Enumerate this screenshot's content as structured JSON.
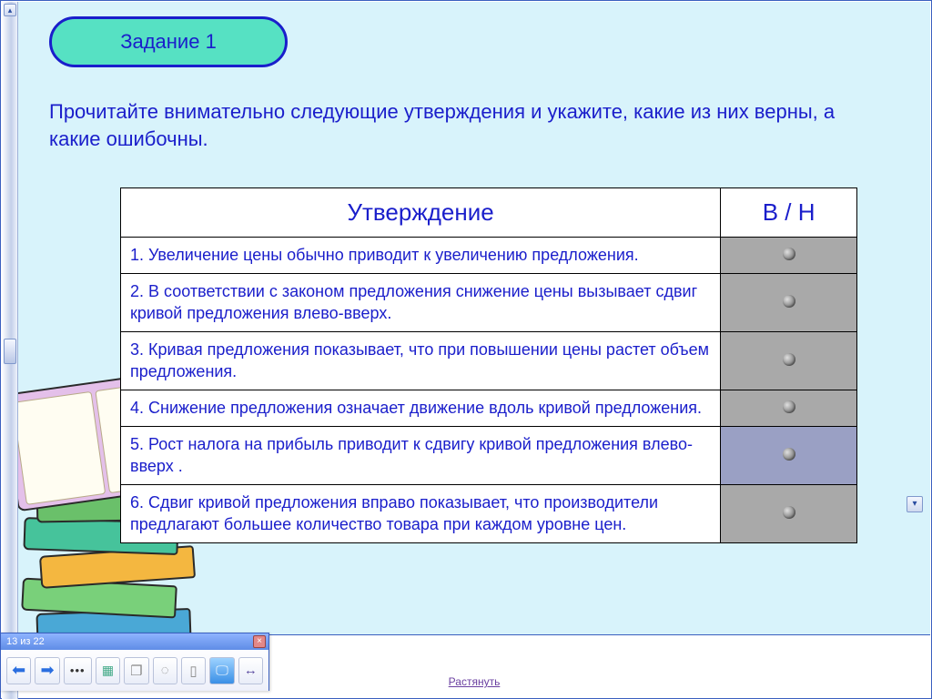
{
  "task": {
    "badge_label": "Задание 1",
    "instruction": "Прочитайте внимательно следующие утверждения и укажите, какие из них верны, а какие ошибочны."
  },
  "table": {
    "header_statement": "Утверждение",
    "header_answer": "В / Н",
    "rows": [
      {
        "text": "1. Увеличение цены обычно приводит к увеличению предложения."
      },
      {
        "text": "2. В соответствии с законом предложения снижение цены вызывает сдвиг кривой предложения влево-вверх."
      },
      {
        "text": "3. Кривая предложения показывает, что при повышении цены растет объем предложения."
      },
      {
        "text": "4. Снижение предложения означает движение вдоль кривой предложения."
      },
      {
        "text": "5. Рост налога на прибыль приводит к сдвигу кривой предложения влево-вверх ."
      },
      {
        "text": "6. Сдвиг кривой предложения вправо показывает, что производители предлагают большее количество товара при каждом уровне цен."
      }
    ]
  },
  "footer": {
    "stretch_label": "Растянуть"
  },
  "toolbar": {
    "title": "13 из 22"
  }
}
